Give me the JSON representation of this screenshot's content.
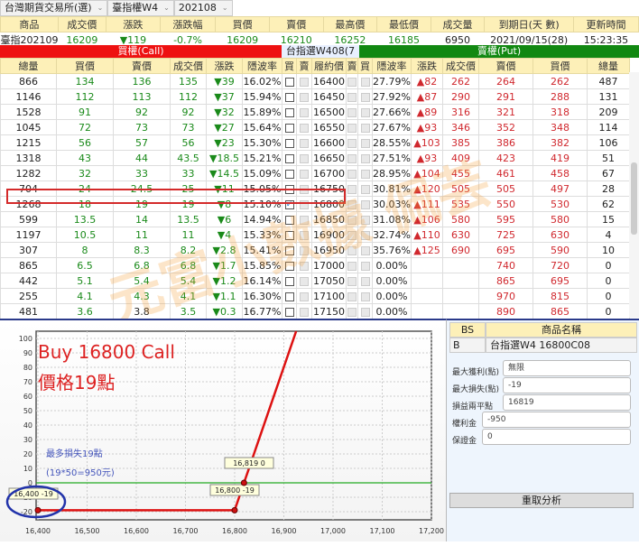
{
  "toolbar": {
    "exchange": "台灣期貨交易所(選)",
    "product": "臺指權W4",
    "month": "202108"
  },
  "quote": {
    "headers": [
      "商品",
      "成交價",
      "漲跌",
      "漲跌幅",
      "買價",
      "賣價",
      "最高價",
      "最低價",
      "成交量",
      "到期日(天 數)",
      "更新時間"
    ],
    "values": [
      "臺指202109",
      "16209",
      "▼119",
      "-0.7%",
      "16209",
      "16210",
      "16252",
      "16185",
      "6950",
      "2021/09/15(28)",
      "15:23:35"
    ]
  },
  "bands": {
    "call": "買權(Call)",
    "series": "台指選W408(7天)",
    "put": "賣權(Put)",
    "call_color": "#ee1111",
    "put_color": "#118811"
  },
  "columns": [
    "總量",
    "買價",
    "賣價",
    "成交價",
    "漲跌",
    "隱波率",
    "買",
    "賣",
    "履約價",
    "賣",
    "買",
    "隱波率",
    "漲跌",
    "成交價",
    "賣價",
    "買價",
    "總量"
  ],
  "rows": [
    [
      "866",
      "134",
      "136",
      "135",
      "▼39",
      "16.02%",
      false,
      "16400",
      "27.79%",
      "▲82",
      "262",
      "264",
      "262",
      "487"
    ],
    [
      "1146",
      "112",
      "113",
      "112",
      "▼37",
      "15.94%",
      false,
      "16450",
      "27.92%",
      "▲87",
      "290",
      "291",
      "288",
      "131"
    ],
    [
      "1528",
      "91",
      "92",
      "92",
      "▼32",
      "15.89%",
      false,
      "16500",
      "27.66%",
      "▲89",
      "316",
      "321",
      "318",
      "209"
    ],
    [
      "1045",
      "72",
      "73",
      "73",
      "▼27",
      "15.64%",
      false,
      "16550",
      "27.67%",
      "▲93",
      "346",
      "352",
      "348",
      "114"
    ],
    [
      "1215",
      "56",
      "57",
      "56",
      "▼23",
      "15.30%",
      false,
      "16600",
      "28.55%",
      "▲103",
      "385",
      "386",
      "382",
      "106"
    ],
    [
      "1318",
      "43",
      "44",
      "43.5",
      "▼18.5",
      "15.21%",
      false,
      "16650",
      "27.51%",
      "▲93",
      "409",
      "423",
      "419",
      "51"
    ],
    [
      "1282",
      "32",
      "33",
      "33",
      "▼14.5",
      "15.09%",
      false,
      "16700",
      "28.95%",
      "▲104",
      "455",
      "461",
      "458",
      "67"
    ],
    [
      "704",
      "24",
      "24.5",
      "25",
      "▼11",
      "15.05%",
      false,
      "16750",
      "30.81%",
      "▲120",
      "505",
      "505",
      "497",
      "28"
    ],
    [
      "1268",
      "18",
      "19",
      "19",
      "▼8",
      "15.10%",
      true,
      "16800",
      "30.03%",
      "▲111",
      "535",
      "550",
      "530",
      "62"
    ],
    [
      "599",
      "13.5",
      "14",
      "13.5",
      "▼6",
      "14.94%",
      false,
      "16850",
      "31.08%",
      "▲106",
      "580",
      "595",
      "580",
      "15"
    ],
    [
      "1197",
      "10.5",
      "11",
      "11",
      "▼4",
      "15.33%",
      false,
      "16900",
      "32.74%",
      "▲110",
      "630",
      "725",
      "630",
      "4"
    ],
    [
      "307",
      "8",
      "8.3",
      "8.2",
      "▼2.8",
      "15.41%",
      false,
      "16950",
      "35.76%",
      "▲125",
      "690",
      "695",
      "590",
      "10"
    ],
    [
      "865",
      "6.5",
      "6.8",
      "6.8",
      "▼1.7",
      "15.85%",
      false,
      "17000",
      "0.00%",
      "",
      "",
      "740",
      "720",
      "0"
    ],
    [
      "442",
      "5.1",
      "5.4",
      "5.4",
      "▼1.2",
      "16.14%",
      false,
      "17050",
      "0.00%",
      "",
      "",
      "865",
      "695",
      "0"
    ],
    [
      "255",
      "4.1",
      "4.3",
      "4.1",
      "▼1.1",
      "16.30%",
      false,
      "17100",
      "0.00%",
      "",
      "",
      "970",
      "815",
      "0"
    ],
    [
      "481",
      "3.6",
      "3.8",
      "3.5",
      "▼0.3",
      "16.77%",
      false,
      "17150",
      "0.00%",
      "",
      "",
      "890",
      "865",
      "0"
    ],
    [
      "55",
      "2.8",
      "3",
      "3",
      "▼0.8",
      "17.24%",
      false,
      "17200",
      "0.00%",
      "",
      "",
      "935",
      "915",
      "0"
    ]
  ],
  "watermark": "元富小數據一佩芸",
  "chart_data": {
    "type": "line",
    "title": "",
    "xlabel": "",
    "ylabel": "",
    "xlim": [
      16400,
      17200
    ],
    "ylim": [
      -20,
      100
    ],
    "xticks": [
      "16,400",
      "16,500",
      "16,600",
      "16,700",
      "16,800",
      "16,900",
      "17,000",
      "17,100",
      "17,200"
    ],
    "yticks": [
      "100",
      "90",
      "80",
      "70",
      "60",
      "50",
      "40",
      "30",
      "20",
      "10",
      "0",
      "-10",
      "-20"
    ],
    "series": [
      {
        "x": [
          16400,
          16800,
          16819,
          16925
        ],
        "y": [
          -19,
          -19,
          0,
          106
        ],
        "color": "#dd1111"
      }
    ],
    "zero_line_color": "#22aa22",
    "points": [
      {
        "x": 16400,
        "y": -19,
        "label": "16,400 -19"
      },
      {
        "x": 16800,
        "y": -19,
        "label": "16,800 -19"
      },
      {
        "x": 16819,
        "y": 0,
        "label": "16,819 0"
      }
    ],
    "annotations": {
      "title1": "Buy 16800 Call",
      "title2": "價格19點",
      "note1": "最多損失19點",
      "note2": "(19*50=950元)"
    },
    "grid": true
  },
  "panel": {
    "bs_header": "BS",
    "name_header": "商品名稱",
    "bs": "B",
    "name": "台指選W4 16800C08",
    "fields": [
      {
        "label": "最大獲利(點)",
        "value": "無限"
      },
      {
        "label": "最大損失(點)",
        "value": "-19"
      },
      {
        "label": "損益兩平點",
        "value": "16819"
      },
      {
        "label": "權利金",
        "value": "-950"
      },
      {
        "label": "保證金",
        "value": "0"
      }
    ],
    "button": "重取分析"
  }
}
